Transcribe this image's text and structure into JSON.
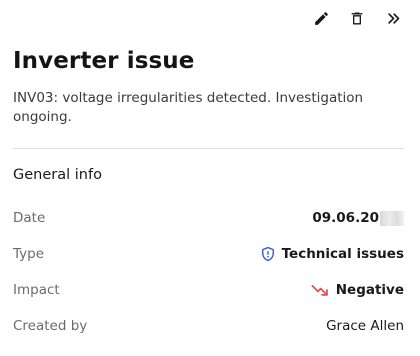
{
  "toolbar": {
    "edit_icon": "pencil-icon",
    "delete_icon": "trash-icon",
    "collapse_icon": "double-chevron-right-icon"
  },
  "issue": {
    "title": "Inverter issue",
    "description": "INV03: voltage irregularities detected. Investigation ongoing."
  },
  "general_info": {
    "heading": "General info",
    "rows": [
      {
        "label": "Date",
        "value": "09.06.20"
      },
      {
        "label": "Type",
        "value": "Technical issues",
        "icon": "shield-icon",
        "icon_color": "#2f5bd9"
      },
      {
        "label": "Impact",
        "value": "Negative",
        "icon": "trend-down-icon",
        "icon_color": "#e05252"
      },
      {
        "label": "Created by",
        "value": "Grace Allen"
      }
    ]
  },
  "colors": {
    "accent_blue": "#2f5bd9",
    "negative_red": "#e05252",
    "text_primary": "#1a1a1a",
    "text_secondary": "#6b6b6b",
    "divider": "#e2e2e2"
  }
}
